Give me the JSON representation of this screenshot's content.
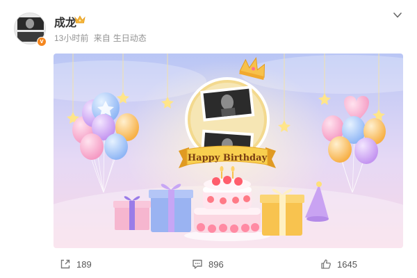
{
  "post": {
    "author": "成龙",
    "time": "13小时前",
    "source_prefix": "来自",
    "source": "生日动态",
    "verified_badge": "v",
    "image": {
      "banner_text": "Happy Birthday"
    }
  },
  "actions": {
    "repost_count": "189",
    "comment_count": "896",
    "like_count": "1645"
  },
  "icons": {
    "crown": "crown-icon",
    "menu": "chevron-down-icon",
    "repost": "share-icon",
    "comment": "comment-icon",
    "like": "thumbs-up-icon"
  },
  "colors": {
    "accent": "#f5871f",
    "text_muted": "#939393",
    "crown_gold": "#f5b53a"
  }
}
